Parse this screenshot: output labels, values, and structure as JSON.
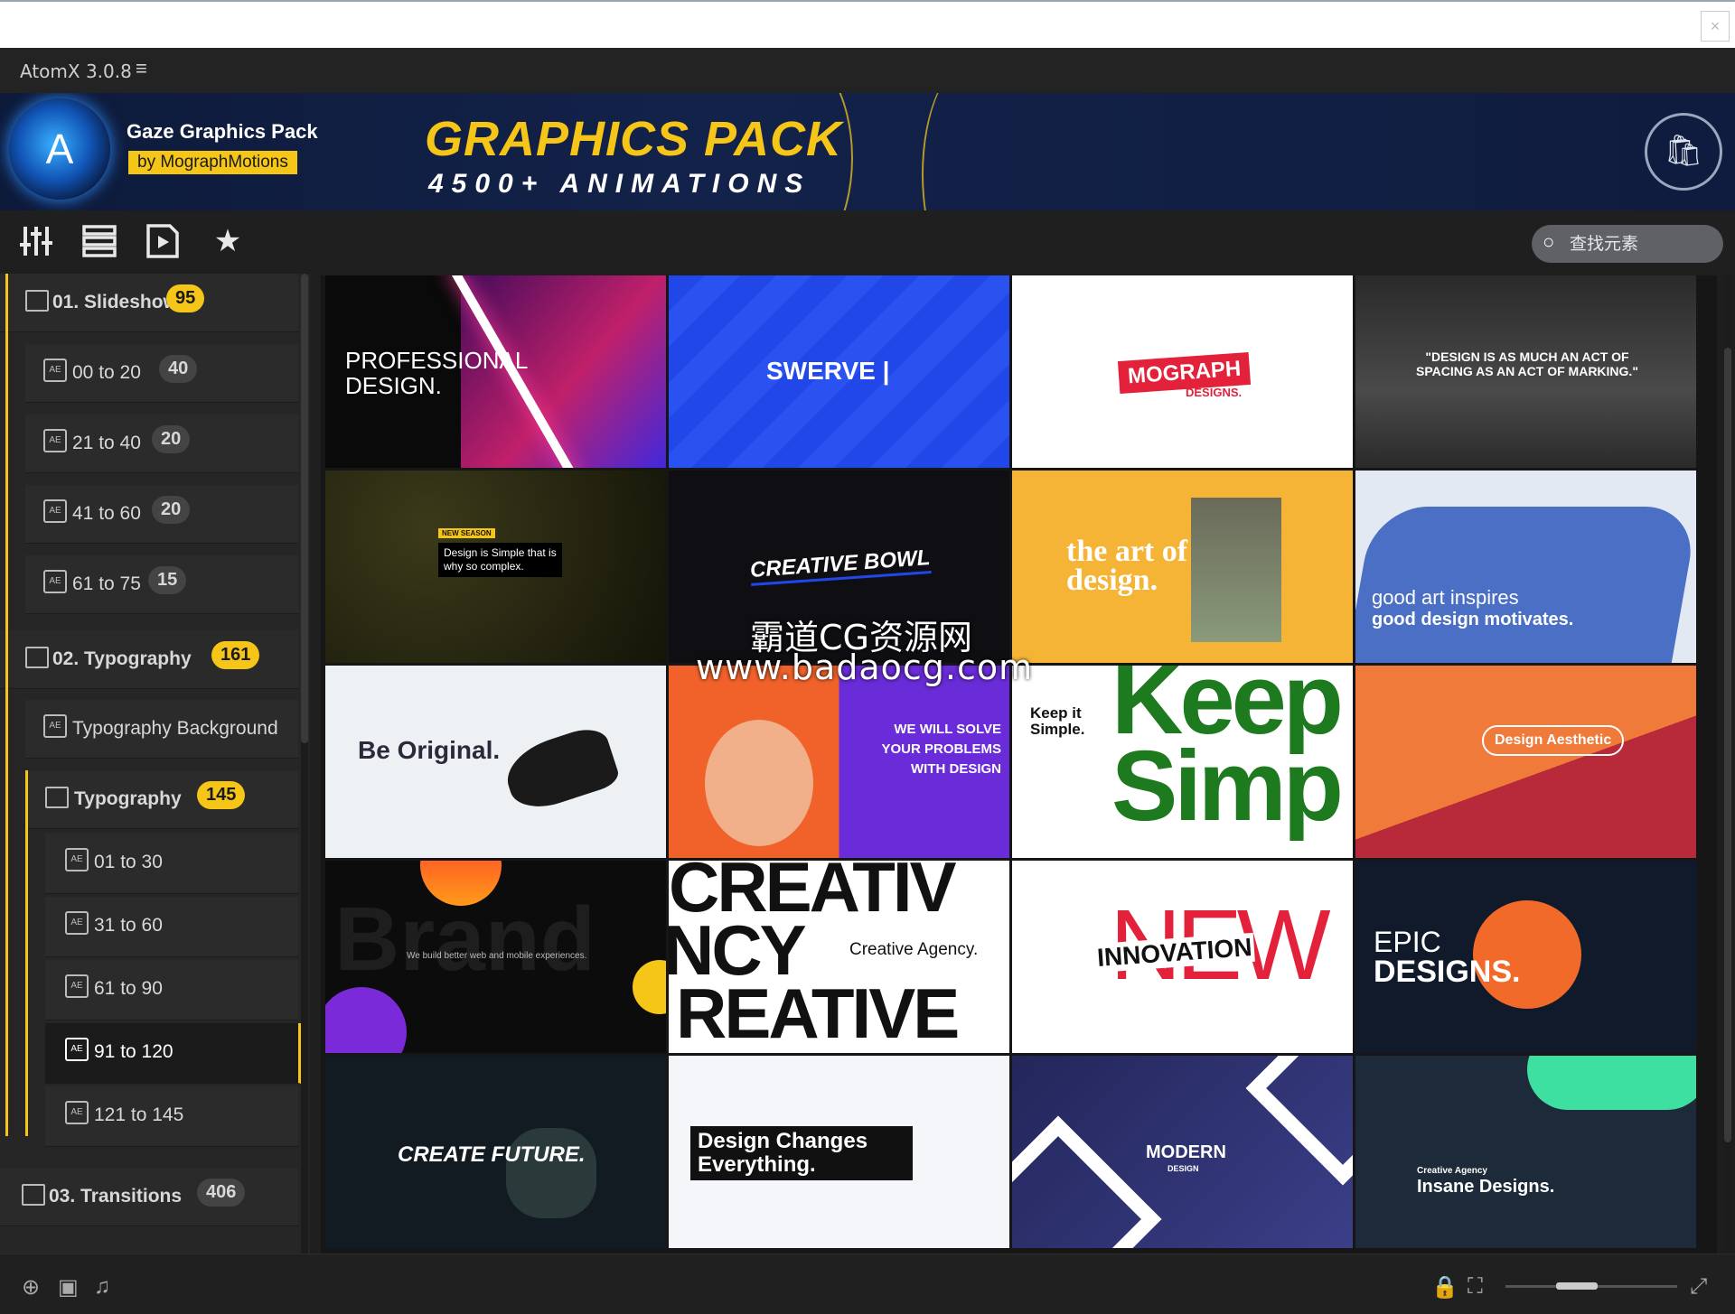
{
  "window": {
    "title": "AtomX 3.0.8",
    "close": "×"
  },
  "banner": {
    "pack_name": "Gaze Graphics Pack",
    "pack_author": "by MographMotions",
    "headline": "GRAPHICS PACK",
    "subheadline": "4500+ ANIMATIONS",
    "logo_letter": "A",
    "accent": "#f5c518",
    "bg": "#0d1a3a"
  },
  "toolbar": {
    "icons": [
      "sliders-icon",
      "list-icon",
      "video-icon",
      "star-icon"
    ],
    "search_placeholder": "查找元素"
  },
  "sidebar": {
    "items": [
      {
        "label": "01. Slideshows",
        "badge": "95",
        "level": 0
      },
      {
        "label": "00 to 20",
        "badge": "40",
        "level": 1
      },
      {
        "label": "21 to 40",
        "badge": "20",
        "level": 1
      },
      {
        "label": "41 to 60",
        "badge": "20",
        "level": 1
      },
      {
        "label": "61 to 75",
        "badge": "15",
        "level": 1
      },
      {
        "label": "02. Typography",
        "badge": "161",
        "level": 0
      },
      {
        "label": "Typography Background",
        "badge": "",
        "level": 1
      },
      {
        "label": "Typography",
        "badge": "145",
        "level": 1
      },
      {
        "label": "01 to 30",
        "badge": "",
        "level": 2
      },
      {
        "label": "31 to 60",
        "badge": "",
        "level": 2
      },
      {
        "label": "61 to 90",
        "badge": "",
        "level": 2
      },
      {
        "label": "91 to 120",
        "badge": "",
        "level": 2,
        "selected": true
      },
      {
        "label": "121 to 145",
        "badge": "",
        "level": 2
      },
      {
        "label": "03. Transitions",
        "badge": "406",
        "level": 0
      }
    ]
  },
  "tiles": [
    {
      "text": "PROFESSIONAL\nDESIGN.",
      "bg": "#0a0a0a"
    },
    {
      "text": "SWERVE |",
      "bg": "#2147e8"
    },
    {
      "text": "MOGRAPH",
      "sub": "DESIGNS.",
      "bg": "#ffffff"
    },
    {
      "text": "\"DESIGN IS AS MUCH AN ACT OF SPACING AS AN ACT OF MARKING.\"",
      "bg": "#3a3a3a"
    },
    {
      "text": "Design is Simple that is why so complex.",
      "tag": "NEW SEASON",
      "bg": "#1d1c12"
    },
    {
      "text": "CREATIVE BOWL",
      "bg": "#0e0e13"
    },
    {
      "text": "the art of design.",
      "bg": "#f5b435"
    },
    {
      "text": "good art inspires",
      "sub": "good design motivates.",
      "bg": "#e3e9f3"
    },
    {
      "text": "Be Original.",
      "bg": "#eef1f4"
    },
    {
      "text": "WE WILL SOLVE YOUR PROBLEMS WITH DESIGN",
      "bg": "#6a2bd8"
    },
    {
      "text": "Keep it Simple.",
      "big": "Keep Simp",
      "bg": "#ffffff"
    },
    {
      "text": "Design Aesthetic",
      "bg": "#ef7a3a"
    },
    {
      "text": "We build better web and mobile experiences.",
      "big": "Brand",
      "bg": "#0c0c0c"
    },
    {
      "text": "Creative Agency.",
      "big1": "CREATIV",
      "big2": "NCY",
      "big3": "REATIVE",
      "bg": "#ffffff"
    },
    {
      "text": "INNOVATION",
      "big": "NEW",
      "bg": "#ffffff"
    },
    {
      "text": "EPIC",
      "sub": "DESIGNS.",
      "bg": "#101a2b"
    },
    {
      "text": "CREATE FUTURE.",
      "bg": "#121a22"
    },
    {
      "text": "Design Changes Everything.",
      "bg": "#f4f6f9"
    },
    {
      "text": "MODERN",
      "sub": "DESIGN",
      "bg": "#23265a"
    },
    {
      "text": "Creative Agency",
      "sub": "Insane Designs.",
      "bg": "#1d2a3a"
    }
  ],
  "watermark": {
    "line1": "霸道CG资源网",
    "line2": "www.badaocg.com"
  },
  "statusbar": {
    "icons": [
      "target-icon",
      "preview-icon",
      "music-icon",
      "lock-icon",
      "frame-icon",
      "expand-icon"
    ]
  }
}
